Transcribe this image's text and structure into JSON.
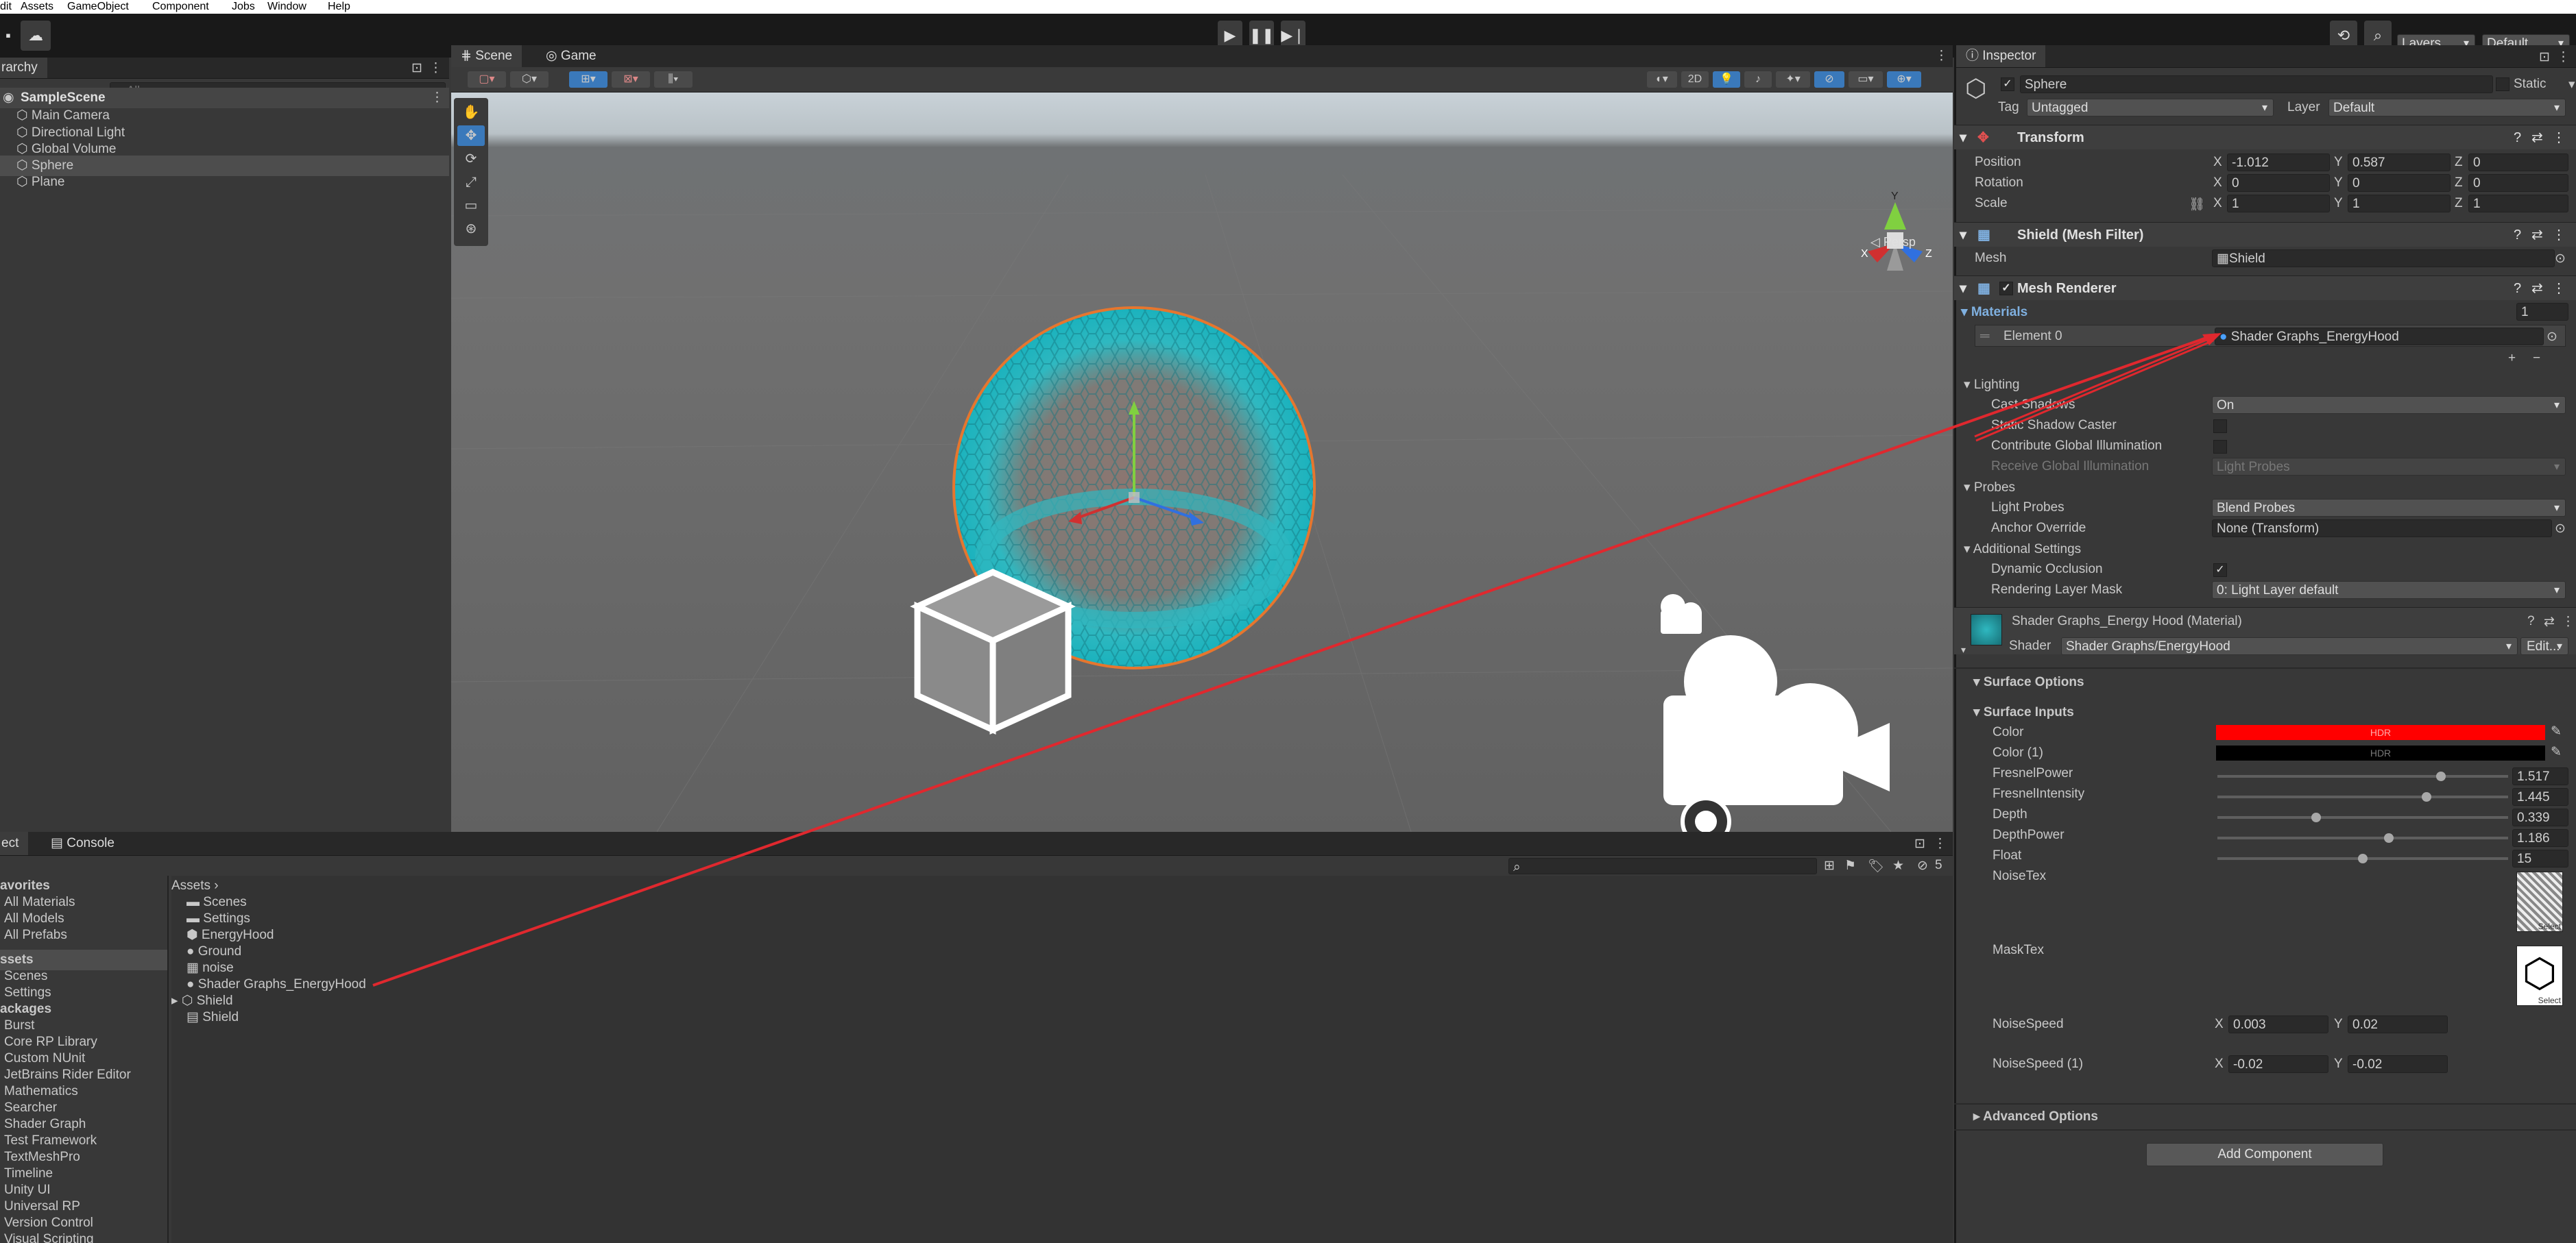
{
  "menubar": {
    "items": [
      "dit",
      "Assets",
      "GameObject",
      "Component",
      "Jobs",
      "Window",
      "Help"
    ]
  },
  "toolbar": {
    "layers": "Layers",
    "layout": "Default"
  },
  "hierarchy": {
    "tab": "rarchy",
    "search_placeholder": "All",
    "scene": "SampleScene",
    "items": [
      "Main Camera",
      "Directional Light",
      "Global Volume",
      "Sphere",
      "Plane"
    ]
  },
  "scene_view": {
    "tabs": [
      "Scene",
      "Game"
    ],
    "persp_label": "◁ Persp",
    "toggle_2d": "2D",
    "axis_labels": {
      "x": "X",
      "y": "Y",
      "z": "Z"
    }
  },
  "project": {
    "tabs": [
      "ect",
      "Console"
    ],
    "badge_count": "5",
    "favorites_header": "avorites",
    "favorites": [
      "All Materials",
      "All Models",
      "All Prefabs"
    ],
    "assets_header": "ssets",
    "assets_tree": [
      "Scenes",
      "Settings"
    ],
    "packages_header": "ackages",
    "packages": [
      "Burst",
      "Core RP Library",
      "Custom NUnit",
      "JetBrains Rider Editor",
      "Mathematics",
      "Searcher",
      "Shader Graph",
      "Test Framework",
      "TextMeshPro",
      "Timeline",
      "Unity UI",
      "Universal RP",
      "Version Control",
      "Visual Scripting"
    ],
    "breadcrumb": "Assets",
    "files": [
      "Scenes",
      "Settings",
      "EnergyHood",
      "Ground",
      "noise",
      "Shader Graphs_EnergyHood",
      "Shield",
      "Shield"
    ]
  },
  "inspector": {
    "tab": "Inspector",
    "object_name": "Sphere",
    "static_label": "Static",
    "tag_label": "Tag",
    "tag_value": "Untagged",
    "layer_label": "Layer",
    "layer_value": "Default",
    "transform": {
      "title": "Transform",
      "position_label": "Position",
      "rotation_label": "Rotation",
      "scale_label": "Scale",
      "position": [
        "-1.012",
        "0.587",
        "0"
      ],
      "rotation": [
        "0",
        "0",
        "0"
      ],
      "scale": [
        "1",
        "1",
        "1"
      ],
      "axes": [
        "X",
        "Y",
        "Z"
      ]
    },
    "mesh_filter": {
      "title": "Shield (Mesh Filter)",
      "mesh_label": "Mesh",
      "mesh_value": "Shield"
    },
    "mesh_renderer": {
      "title": "Mesh Renderer",
      "materials_label": "Materials",
      "materials_count": "1",
      "element0_label": "Element 0",
      "element0_value": "Shader Graphs_EnergyHood",
      "plus": "+",
      "minus": "−",
      "lighting_label": "Lighting",
      "cast_shadows_label": "Cast Shadows",
      "cast_shadows_value": "On",
      "static_shadow_label": "Static Shadow Caster",
      "contribute_gi_label": "Contribute Global Illumination",
      "receive_gi_label": "Receive Global Illumination",
      "receive_gi_value": "Light Probes",
      "probes_label": "Probes",
      "light_probes_label": "Light Probes",
      "light_probes_value": "Blend Probes",
      "anchor_label": "Anchor Override",
      "anchor_value": "None (Transform)",
      "additional_label": "Additional Settings",
      "dynamic_occlusion_label": "Dynamic Occlusion",
      "rendering_layer_label": "Rendering Layer Mask",
      "rendering_layer_value": "0: Light Layer default"
    },
    "material": {
      "title": "Shader Graphs_Energy Hood (Material)",
      "shader_label": "Shader",
      "shader_value": "Shader Graphs/EnergyHood",
      "edit_button": "Edit...",
      "surface_options": "Surface Options",
      "surface_inputs": "Surface Inputs",
      "color_label": "Color",
      "color1_label": "Color (1)",
      "hdr": "HDR",
      "color_hex": "#ff0000",
      "color1_hex": "#000000",
      "sliders": [
        {
          "label": "FresnelPower",
          "value": "1.517",
          "pos": 0.77
        },
        {
          "label": "FresnelIntensity",
          "value": "1.445",
          "pos": 0.72
        },
        {
          "label": "Depth",
          "value": "0.339",
          "pos": 0.34
        },
        {
          "label": "DepthPower",
          "value": "1.186",
          "pos": 0.59
        },
        {
          "label": "Float",
          "value": "15",
          "pos": 0.5
        }
      ],
      "noise_tex_label": "NoiseTex",
      "mask_tex_label": "MaskTex",
      "select_label": "Select",
      "noise_speed_label": "NoiseSpeed",
      "noise_speed": [
        "0.003",
        "0.02"
      ],
      "noise_speed1_label": "NoiseSpeed (1)",
      "noise_speed1": [
        "-0.02",
        "-0.02"
      ],
      "advanced_options": "Advanced Options"
    },
    "add_component": "Add Component"
  },
  "colors": {
    "arrow": "#e0282e",
    "shield": "#2fb8c0",
    "accent": "#3a79bb"
  }
}
